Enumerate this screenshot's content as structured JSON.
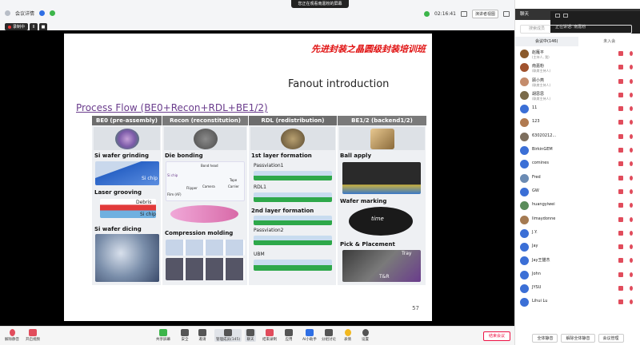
{
  "topbar": {
    "meeting_info": "会议详情",
    "share_banner": "您正在观看南嘉粉的屏幕",
    "clock": "02:16:41",
    "view_label": "演讲者视图"
  },
  "recording": {
    "label": "录制中",
    "pause": "II",
    "stop": "■"
  },
  "slide": {
    "banner": "先进封装之晶圆级封装培训班",
    "title": "Fanout introduction",
    "subtitle": "Process Flow (BE0+Recon+RDL+BE1/2)",
    "page": "57",
    "headers": [
      "BE0 (pre-assembly)",
      "Recon (reconstitution)",
      "RDL (redistribution)",
      "BE1/2 (backend1/2)"
    ],
    "be0": [
      "Si wafer grinding",
      "Laser grooving",
      "Si wafer dicing"
    ],
    "be0_small": [
      "Si chip",
      "Debris",
      "Si chip"
    ],
    "recon": [
      "Die bonding",
      "Compression molding"
    ],
    "recon_small": [
      "Bond head",
      "Camera",
      "Carrier",
      "Tape",
      "Film (AF)",
      "Flipper",
      "Si chip"
    ],
    "rdl": [
      "1st layer formation",
      "2nd layer formation"
    ],
    "rdl_small": [
      "Passviation1",
      "RDL1",
      "Passviation2",
      "UBM"
    ],
    "be12": [
      "Ball apply",
      "Wafer marking",
      "Pick & Placement"
    ],
    "be12_small": [
      "time",
      "Tray",
      "T&R"
    ]
  },
  "toolbar": {
    "left": [
      "解除静音",
      "开启视频"
    ],
    "center": [
      "共享屏幕",
      "安全",
      "邀请",
      "管理成员(145)",
      "聊天",
      "结束录制",
      "应用",
      "AI小助手",
      "分组讨论",
      "表情",
      "设置"
    ],
    "end": "结束会议"
  },
  "panel": {
    "header": "聊天",
    "speaking": "正在讲话: 南嘉粉",
    "search_placeholder": "搜索成员",
    "tabs": [
      "会议中(146)",
      "未入会"
    ],
    "participants": [
      {
        "name": "赵雁平",
        "role": "(主持人, 我)",
        "color": "#8b5a2b"
      },
      {
        "name": "南嘉粉",
        "role": "(联席主持人)",
        "color": "#a0522d"
      },
      {
        "name": "顾小燕",
        "role": "(联席主持人)",
        "color": "#c48c6c"
      },
      {
        "name": "胡思思",
        "role": "(联席主持人)",
        "color": "#7a6a4a"
      },
      {
        "name": "11",
        "role": "",
        "color": "#3b6fd6"
      },
      {
        "name": "123",
        "role": "",
        "color": "#b07a50"
      },
      {
        "name": "63020212...",
        "role": "",
        "color": "#7d6e5e"
      },
      {
        "name": "BirkinGEM",
        "role": "",
        "color": "#3b6fd6"
      },
      {
        "name": "comines",
        "role": "",
        "color": "#3b6fd6"
      },
      {
        "name": "Fred",
        "role": "",
        "color": "#6b8bb3"
      },
      {
        "name": "GW",
        "role": "",
        "color": "#3b6fd6"
      },
      {
        "name": "huangyiwei",
        "role": "",
        "color": "#5a8c5a"
      },
      {
        "name": "limaydonne",
        "role": "",
        "color": "#a47a52"
      },
      {
        "name": "J.Y.",
        "role": "",
        "color": "#3b6fd6"
      },
      {
        "name": "Jay",
        "role": "",
        "color": "#3b6fd6"
      },
      {
        "name": "Jay王猫杰",
        "role": "",
        "color": "#3b6fd6"
      },
      {
        "name": "John",
        "role": "",
        "color": "#3b6fd6"
      },
      {
        "name": "JYSU",
        "role": "",
        "color": "#3b6fd6"
      },
      {
        "name": "Lihui Lu",
        "role": "",
        "color": "#3b6fd6"
      }
    ],
    "footer": [
      "全体静音",
      "解除全体静音",
      "会议管理"
    ]
  },
  "colors": {
    "accent": "#2f6fe4",
    "mute": "#e14c5c",
    "slide_banner": "#e01010"
  }
}
